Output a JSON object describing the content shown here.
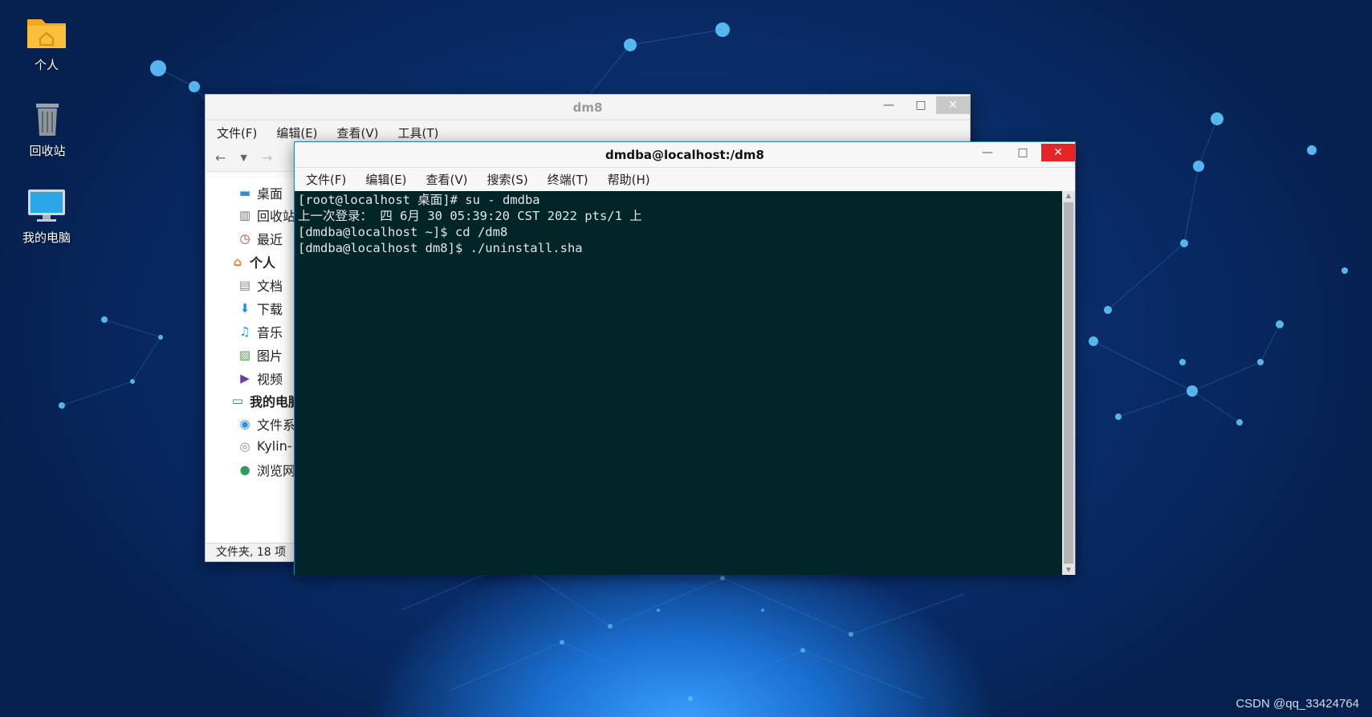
{
  "desktop": {
    "icons": [
      {
        "label": "个人"
      },
      {
        "label": "回收站"
      },
      {
        "label": "我的电脑"
      }
    ]
  },
  "file_manager": {
    "title": "dm8",
    "menu": [
      "文件(F)",
      "编辑(E)",
      "查看(V)",
      "工具(T)"
    ],
    "sidebar": [
      {
        "label": "桌面"
      },
      {
        "label": "回收站"
      },
      {
        "label": "最近"
      },
      {
        "label": "个人"
      },
      {
        "label": "文档"
      },
      {
        "label": "下载"
      },
      {
        "label": "音乐"
      },
      {
        "label": "图片"
      },
      {
        "label": "视频"
      },
      {
        "label": "我的电脑"
      },
      {
        "label": "文件系统"
      },
      {
        "label": "Kylin-"
      },
      {
        "label": "浏览网络"
      }
    ],
    "status": "文件夹, 18 项"
  },
  "terminal": {
    "title": "dmdba@localhost:/dm8",
    "menu": [
      "文件(F)",
      "编辑(E)",
      "查看(V)",
      "搜索(S)",
      "终端(T)",
      "帮助(H)"
    ],
    "lines": [
      "[root@localhost 桌面]# su - dmdba",
      "上一次登录： 四 6月 30 05:39:20 CST 2022 pts/1 上",
      "[dmdba@localhost ~]$ cd /dm8",
      "[dmdba@localhost dm8]$ ./uninstall.sha"
    ]
  },
  "window_controls": {
    "minimize": "—",
    "maximize": "□",
    "close": "✕"
  },
  "watermark": "CSDN @qq_33424764",
  "colors": {
    "terminal_bg": "#022527",
    "close_button": "#e52525",
    "desktop_bg": "#0a2f6e"
  }
}
